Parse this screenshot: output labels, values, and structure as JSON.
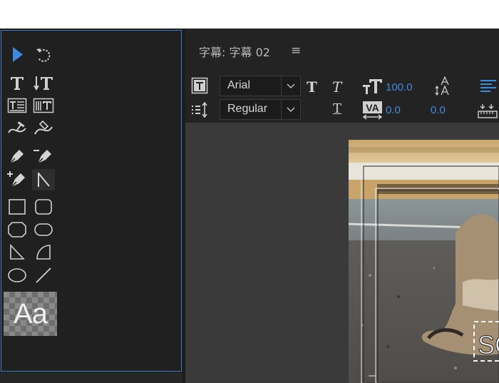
{
  "tools_panel": {
    "tools": [
      {
        "icon": "selection-arrow-icon"
      },
      {
        "icon": "rotate-icon"
      },
      {
        "icon": "type-tool-icon"
      },
      {
        "icon": "vertical-type-tool-icon"
      },
      {
        "icon": "area-type-tool-icon"
      },
      {
        "icon": "vertical-area-type-tool-icon"
      },
      {
        "icon": "path-type-tool-icon"
      },
      {
        "icon": "vertical-path-type-tool-icon"
      },
      {
        "icon": "pen-tool-icon"
      },
      {
        "icon": "delete-anchor-point-icon"
      },
      {
        "icon": "add-anchor-point-icon"
      },
      {
        "icon": "convert-anchor-point-icon"
      },
      {
        "icon": "rectangle-tool-icon"
      },
      {
        "icon": "rounded-rectangle-tool-icon"
      },
      {
        "icon": "clipped-corner-rectangle-tool-icon"
      },
      {
        "icon": "rounded-corner-rectangle-tool-icon"
      },
      {
        "icon": "wedge-tool-icon"
      },
      {
        "icon": "arc-tool-icon"
      },
      {
        "icon": "ellipse-tool-icon"
      },
      {
        "icon": "line-tool-icon"
      }
    ],
    "style_swatch_label": "Aa"
  },
  "title_panel": {
    "title": "字幕: 字幕 02",
    "menu_glyph": "≡",
    "font_family": "Arial",
    "font_style": "Regular",
    "font_size": "100.0",
    "kerning": "0.0",
    "tracking": "0.0",
    "bold_glyph": "T",
    "italic_glyph": "T",
    "underline_glyph": "T"
  },
  "colors": {
    "accent_blue": "#3d8bde",
    "panel_border": "#3a7dc9",
    "panel_bg": "#202020"
  }
}
